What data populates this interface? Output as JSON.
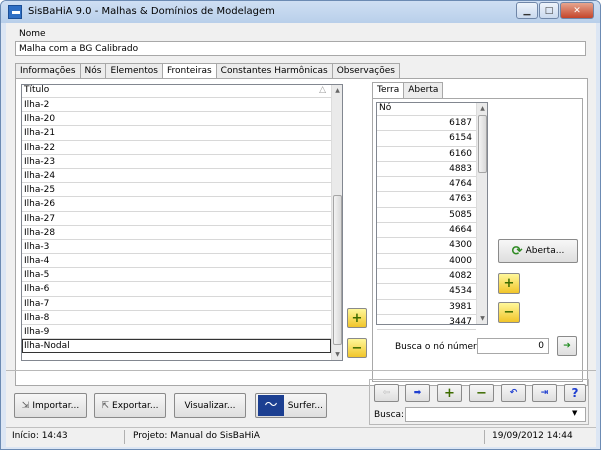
{
  "window": {
    "title": "SisBaHiA 9.0 - Malhas & Domínios de Modelagem",
    "minimize": "▁",
    "maximize": "□",
    "close": "✕"
  },
  "nome": {
    "label": "Nome",
    "value": "Malha com a BG Calibrado"
  },
  "tabs": [
    "Informações",
    "Nós",
    "Elementos",
    "Fronteiras",
    "Constantes Harmônicas",
    "Observações"
  ],
  "titulo_list": {
    "header": "Título",
    "sort_icon": "△",
    "items": [
      "Ilha-2",
      "Ilha-20",
      "Ilha-21",
      "Ilha-22",
      "Ilha-23",
      "Ilha-24",
      "Ilha-25",
      "Ilha-26",
      "Ilha-27",
      "Ilha-28",
      "Ilha-3",
      "Ilha-4",
      "Ilha-5",
      "Ilha-6",
      "Ilha-7",
      "Ilha-8",
      "Ilha-9",
      "Ilha-Nodal"
    ]
  },
  "subtabs": [
    "Terra",
    "Aberta"
  ],
  "no_list": {
    "header": "Nó",
    "values": [
      "6187",
      "6154",
      "6160",
      "4883",
      "4764",
      "4763",
      "5085",
      "4664",
      "4300",
      "4000",
      "4082",
      "4534",
      "3981",
      "3447"
    ]
  },
  "aberta_button": "Aberta...",
  "busca_no": {
    "label": "Busca o nó número:",
    "value": "0"
  },
  "bottom_buttons": {
    "importar": "Importar...",
    "exportar": "Exportar...",
    "visualizar": "Visualizar...",
    "surfer": "Surfer..."
  },
  "busca": {
    "label": "Busca:",
    "value": ""
  },
  "status": {
    "inicio": "Início: 14:43",
    "projeto": "Projeto: Manual do SisBaHiA",
    "datetime": "19/09/2012 14:44"
  }
}
